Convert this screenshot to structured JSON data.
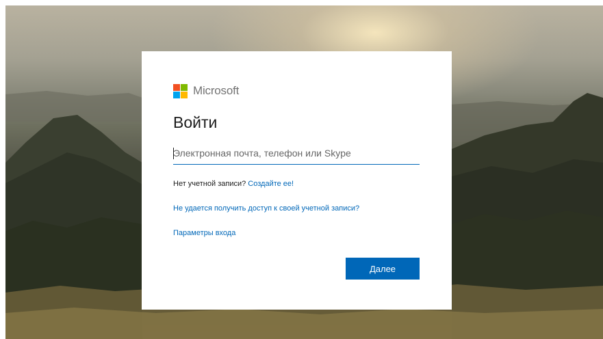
{
  "brand": {
    "name": "Microsoft",
    "logo_colors": [
      "#f25022",
      "#7fba00",
      "#00a4ef",
      "#ffb900"
    ]
  },
  "signin": {
    "title": "Войти",
    "email_placeholder": "Электронная почта, телефон или Skype",
    "no_account_text": "Нет учетной записи?",
    "create_link": "Создайте ее!",
    "cant_access_link": "Не удается получить доступ к своей учетной записи?",
    "signin_options_link": "Параметры входа",
    "next_button": "Далее"
  },
  "colors": {
    "accent": "#0067b8",
    "text": "#1b1b1b"
  }
}
